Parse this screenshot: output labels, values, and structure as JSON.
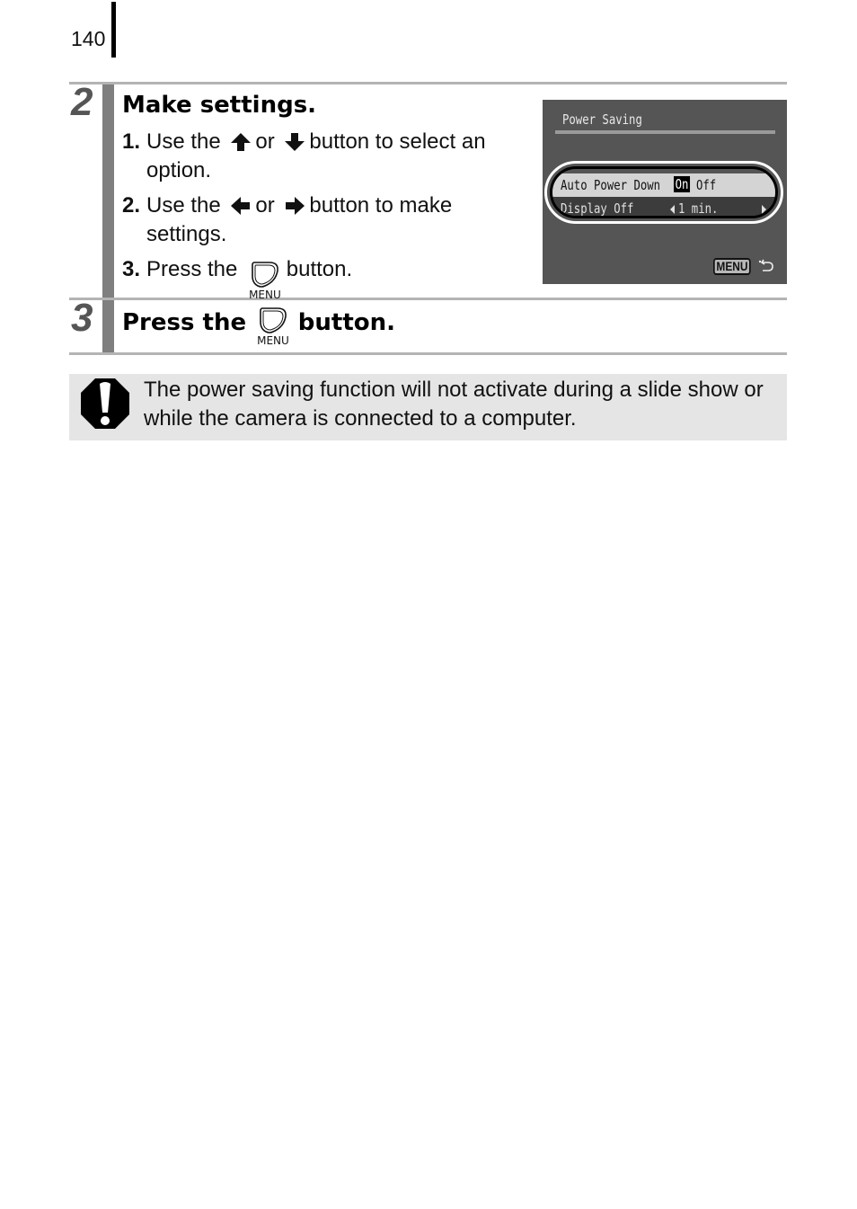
{
  "page": {
    "number": "140"
  },
  "steps": [
    {
      "number": "2",
      "title": "Make settings.",
      "substeps": [
        {
          "num": "1.",
          "before": "Use the",
          "icon1": "up-arrow-icon",
          "or": "or",
          "icon2": "down-arrow-icon",
          "after": "button to select an",
          "line2": "option."
        },
        {
          "num": "2.",
          "before": "Use the",
          "icon1": "left-arrow-icon",
          "or": "or",
          "icon2": "right-arrow-icon",
          "after": "button to make",
          "line2": "settings."
        },
        {
          "num": "3.",
          "before": "Press the",
          "icon1": "menu-button-icon",
          "icon_label": "MENU",
          "after": "button."
        }
      ]
    },
    {
      "number": "3",
      "title_before": "Press the",
      "icon": "menu-button-icon",
      "icon_label": "MENU",
      "title_after": "button."
    }
  ],
  "camera_screen": {
    "title": "Power Saving",
    "rows": [
      {
        "label": "Auto Power Down",
        "options": [
          "On",
          "Off"
        ],
        "selected": "On"
      },
      {
        "label": "Display Off",
        "value": "1 min."
      }
    ],
    "footer_button": "MENU",
    "footer_icon": "return-icon"
  },
  "caution": {
    "icon": "caution-icon",
    "text": "The power saving function will not activate during a slide show or while the camera is connected to a computer."
  }
}
